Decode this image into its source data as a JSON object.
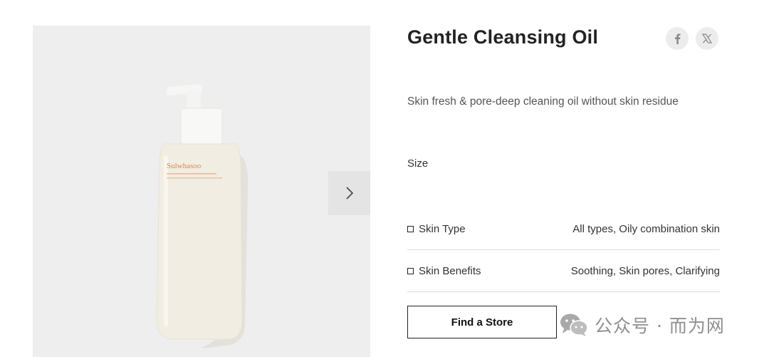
{
  "product": {
    "title": "Gentle Cleansing Oil",
    "description": "Skin fresh & pore-deep cleaning oil without skin residue",
    "size_label": "Size",
    "brand_on_bottle": "Sulwhasoo"
  },
  "attributes": [
    {
      "label": "Skin Type",
      "value": "All types, Oily combination skin"
    },
    {
      "label": "Skin Benefits",
      "value": "Soothing, Skin pores, Clarifying"
    }
  ],
  "actions": {
    "find_store_label": "Find a Store"
  },
  "share": {
    "facebook_icon": "f",
    "x_icon": "𝕏"
  },
  "watermark": {
    "text": "公众号 · 而为网"
  },
  "colors": {
    "gallery_bg": "#eeeeee",
    "bottle": "#f3efe4",
    "brand_orange": "#e2874a"
  }
}
